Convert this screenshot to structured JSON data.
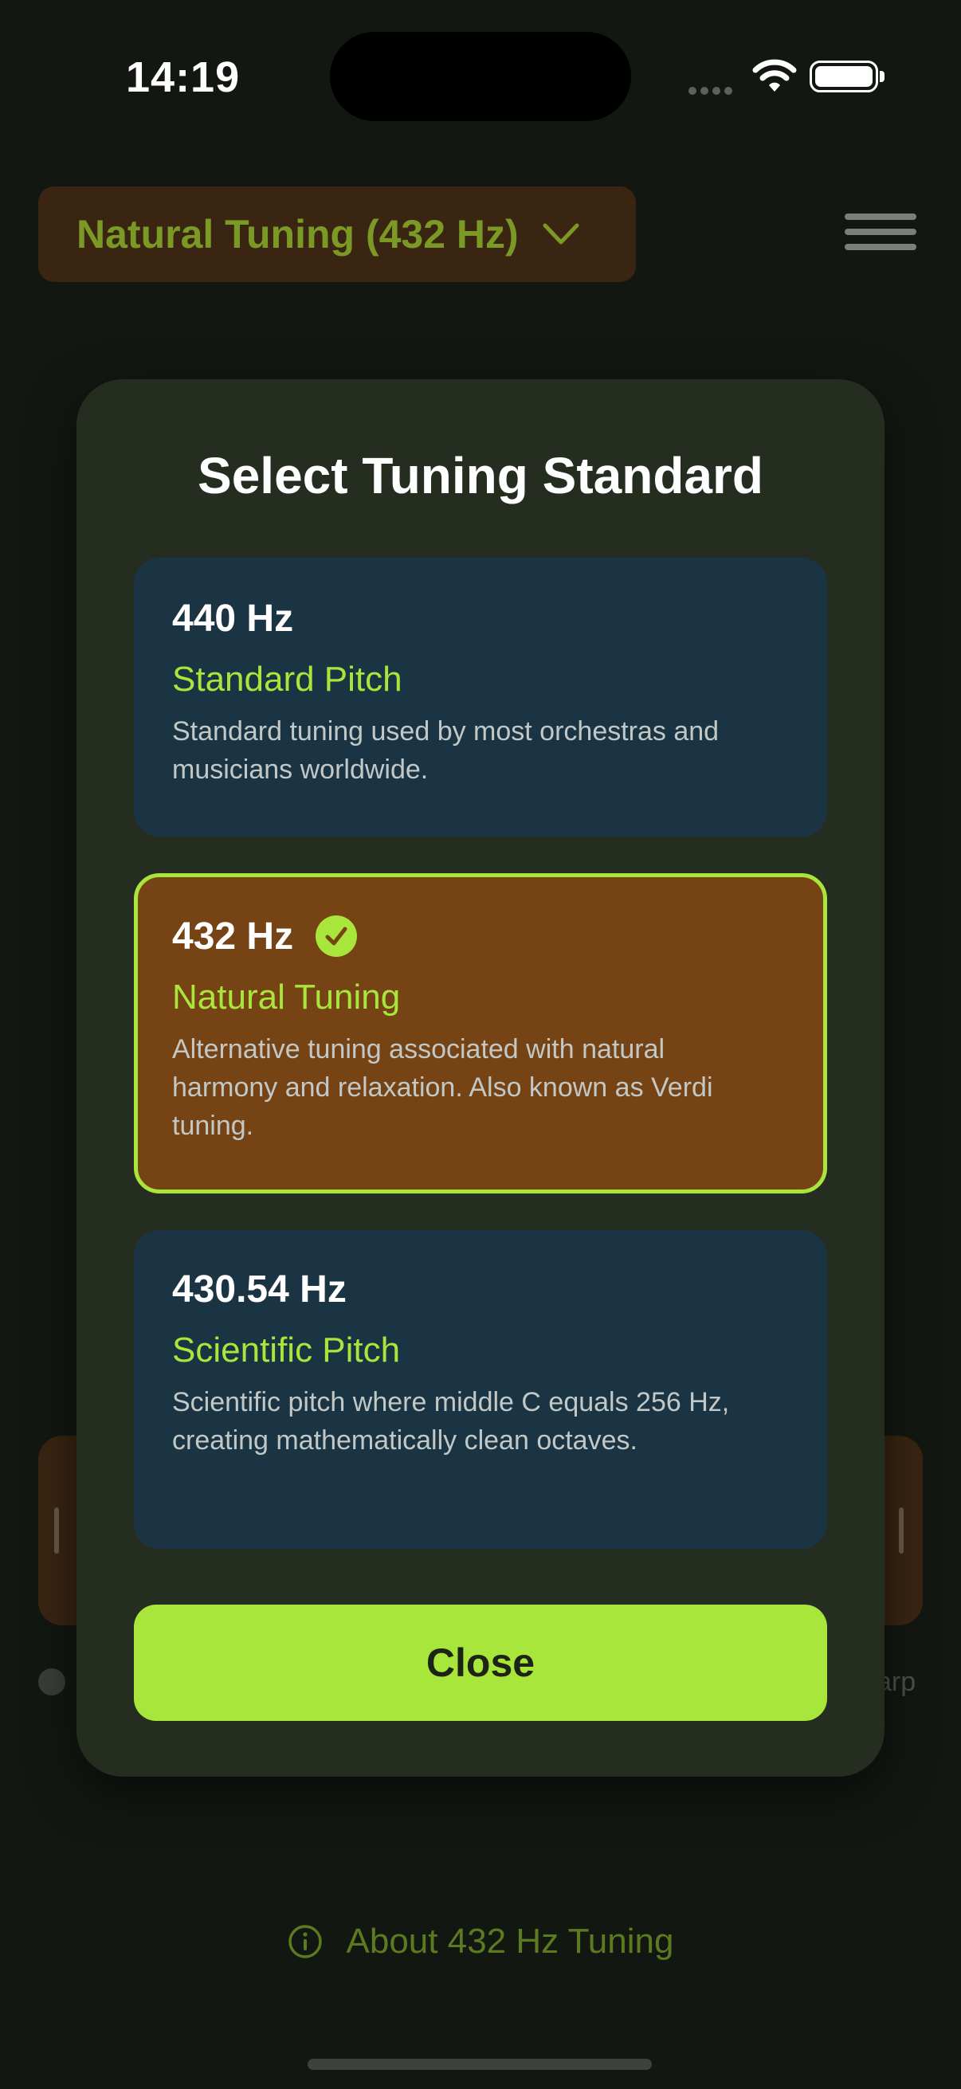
{
  "status_bar": {
    "time": "14:19"
  },
  "header": {
    "dropdown_label": "Natural Tuning (432 Hz)"
  },
  "background": {
    "right_text": "arp"
  },
  "modal": {
    "title": "Select Tuning Standard",
    "options": [
      {
        "frequency": "440 Hz",
        "name": "Standard Pitch",
        "description": "Standard tuning used by most orchestras and musicians worldwide.",
        "selected": false
      },
      {
        "frequency": "432 Hz",
        "name": "Natural Tuning",
        "description": "Alternative tuning associated with natural harmony and relaxation. Also known as Verdi tuning.",
        "selected": true
      },
      {
        "frequency": "430.54 Hz",
        "name": "Scientific Pitch",
        "description": "Scientific pitch where middle C equals 256 Hz, creating mathematically clean octaves.",
        "selected": false
      }
    ],
    "close_label": "Close"
  },
  "footer": {
    "about_label": "About 432 Hz Tuning"
  },
  "colors": {
    "accent": "#a8e63b",
    "selected_card": "#764314",
    "option_card": "#1b3443",
    "modal_bg": "#252c20",
    "page_bg": "#131711"
  }
}
